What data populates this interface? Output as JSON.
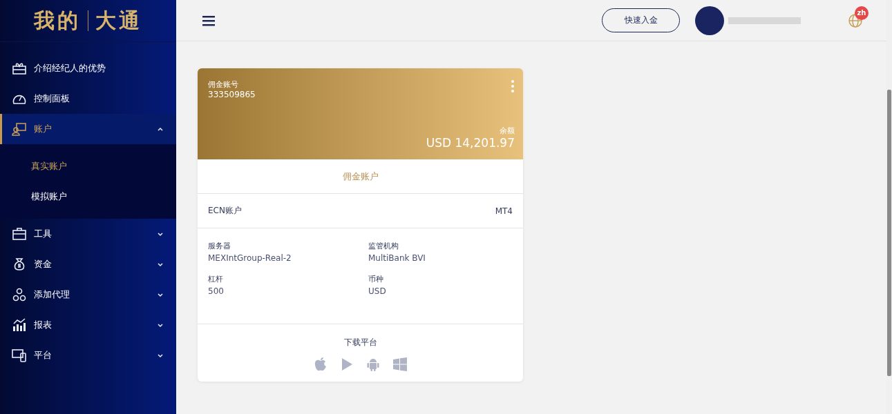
{
  "sidebar": {
    "logo": [
      "我的",
      "大通"
    ],
    "items": [
      {
        "label": "介绍经纪人的优势",
        "kind": "link",
        "selected": false
      },
      {
        "label": "控制面板",
        "kind": "link",
        "selected": false
      },
      {
        "label": "账户",
        "kind": "group",
        "selected": true,
        "expanded": true,
        "children": [
          {
            "label": "真实账户",
            "selected": true
          },
          {
            "label": "模拟账户",
            "selected": false
          }
        ]
      },
      {
        "label": "工具",
        "kind": "group",
        "selected": false,
        "expanded": false
      },
      {
        "label": "资金",
        "kind": "group",
        "selected": false,
        "expanded": false
      },
      {
        "label": "添加代理",
        "kind": "group",
        "selected": false,
        "expanded": false
      },
      {
        "label": "报表",
        "kind": "group",
        "selected": false,
        "expanded": false
      },
      {
        "label": "平台",
        "kind": "group",
        "selected": false,
        "expanded": false
      }
    ]
  },
  "header": {
    "deposit_button": "快速入金",
    "language": "zh"
  },
  "card": {
    "number_label": "佣金账号",
    "number": "333509865",
    "balance_label": "余额",
    "balance": "USD 14,201.97",
    "account_type": "佣金账户",
    "type_left": "ECN账户",
    "type_right": "MT4",
    "details": [
      {
        "label": "服务器",
        "value": "MEXIntGroup-Real-2"
      },
      {
        "label": "监管机构",
        "value": "MultiBank BVI"
      },
      {
        "label": "杠杆",
        "value": "500"
      },
      {
        "label": "币种",
        "value": "USD"
      }
    ],
    "download_label": "下载平台"
  }
}
